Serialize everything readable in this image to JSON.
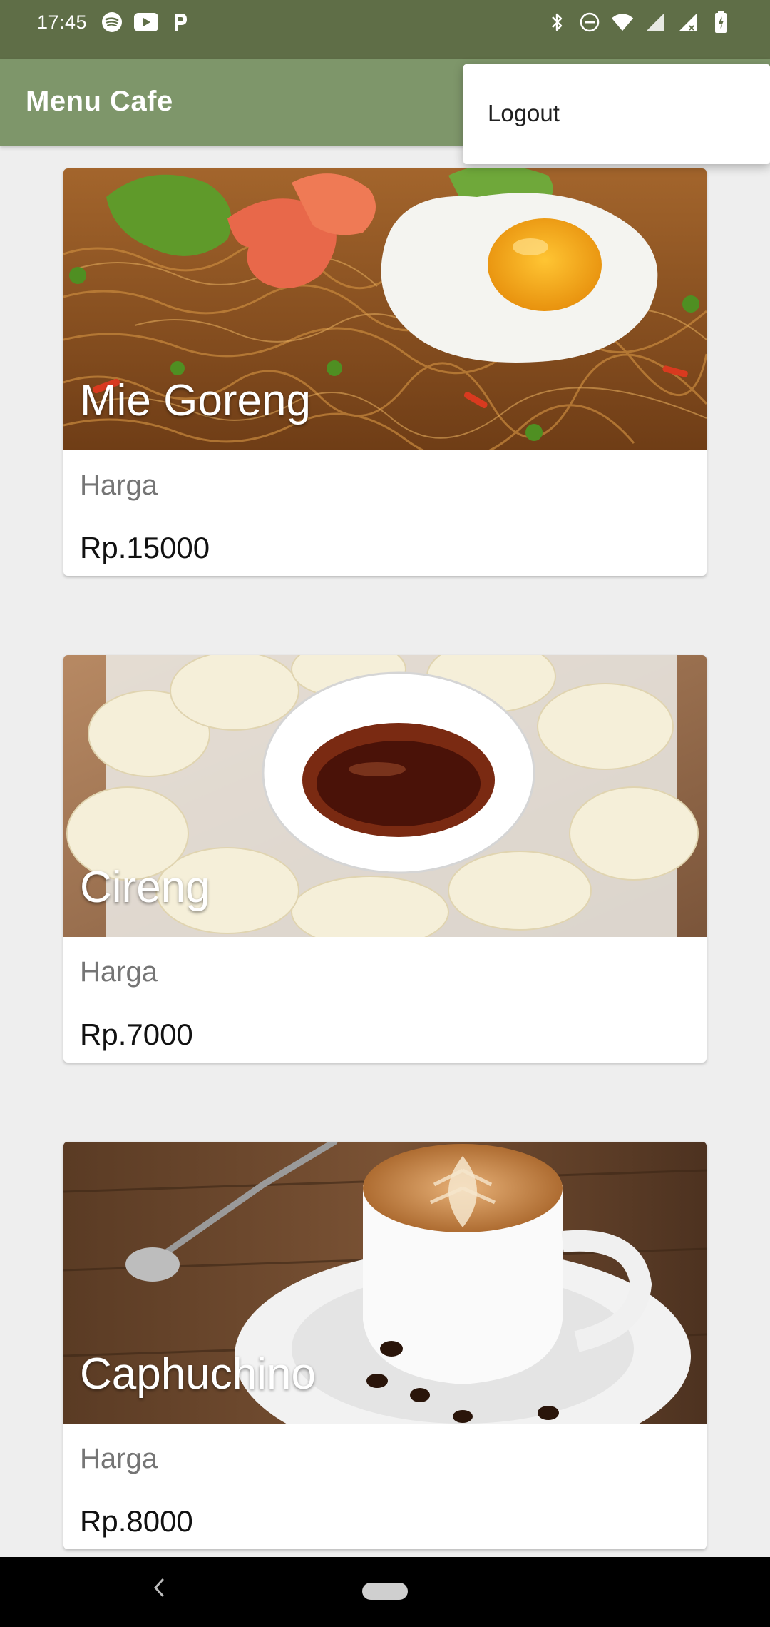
{
  "status_bar": {
    "time": "17:45",
    "left_icons": [
      "spotify-icon",
      "youtube-icon",
      "pandora-icon"
    ],
    "right_icons": [
      "bluetooth-icon",
      "dnd-icon",
      "wifi-icon",
      "signal-icon",
      "signal-icon",
      "battery-icon"
    ]
  },
  "app_bar": {
    "title": "Menu Cafe",
    "color": "#7e966a"
  },
  "menu_popup": {
    "items": [
      {
        "label": "Logout"
      }
    ]
  },
  "menu_items": [
    {
      "name": "Mie Goreng",
      "price_label": "Harga",
      "price": "Rp.15000"
    },
    {
      "name": "Cireng",
      "price_label": "Harga",
      "price": "Rp.7000"
    },
    {
      "name": "Caphuchino",
      "price_label": "Harga",
      "price": "Rp.8000"
    }
  ],
  "colors": {
    "status_bar": "#5f6e47",
    "app_bar": "#7e966a",
    "background": "#eeeeee"
  }
}
